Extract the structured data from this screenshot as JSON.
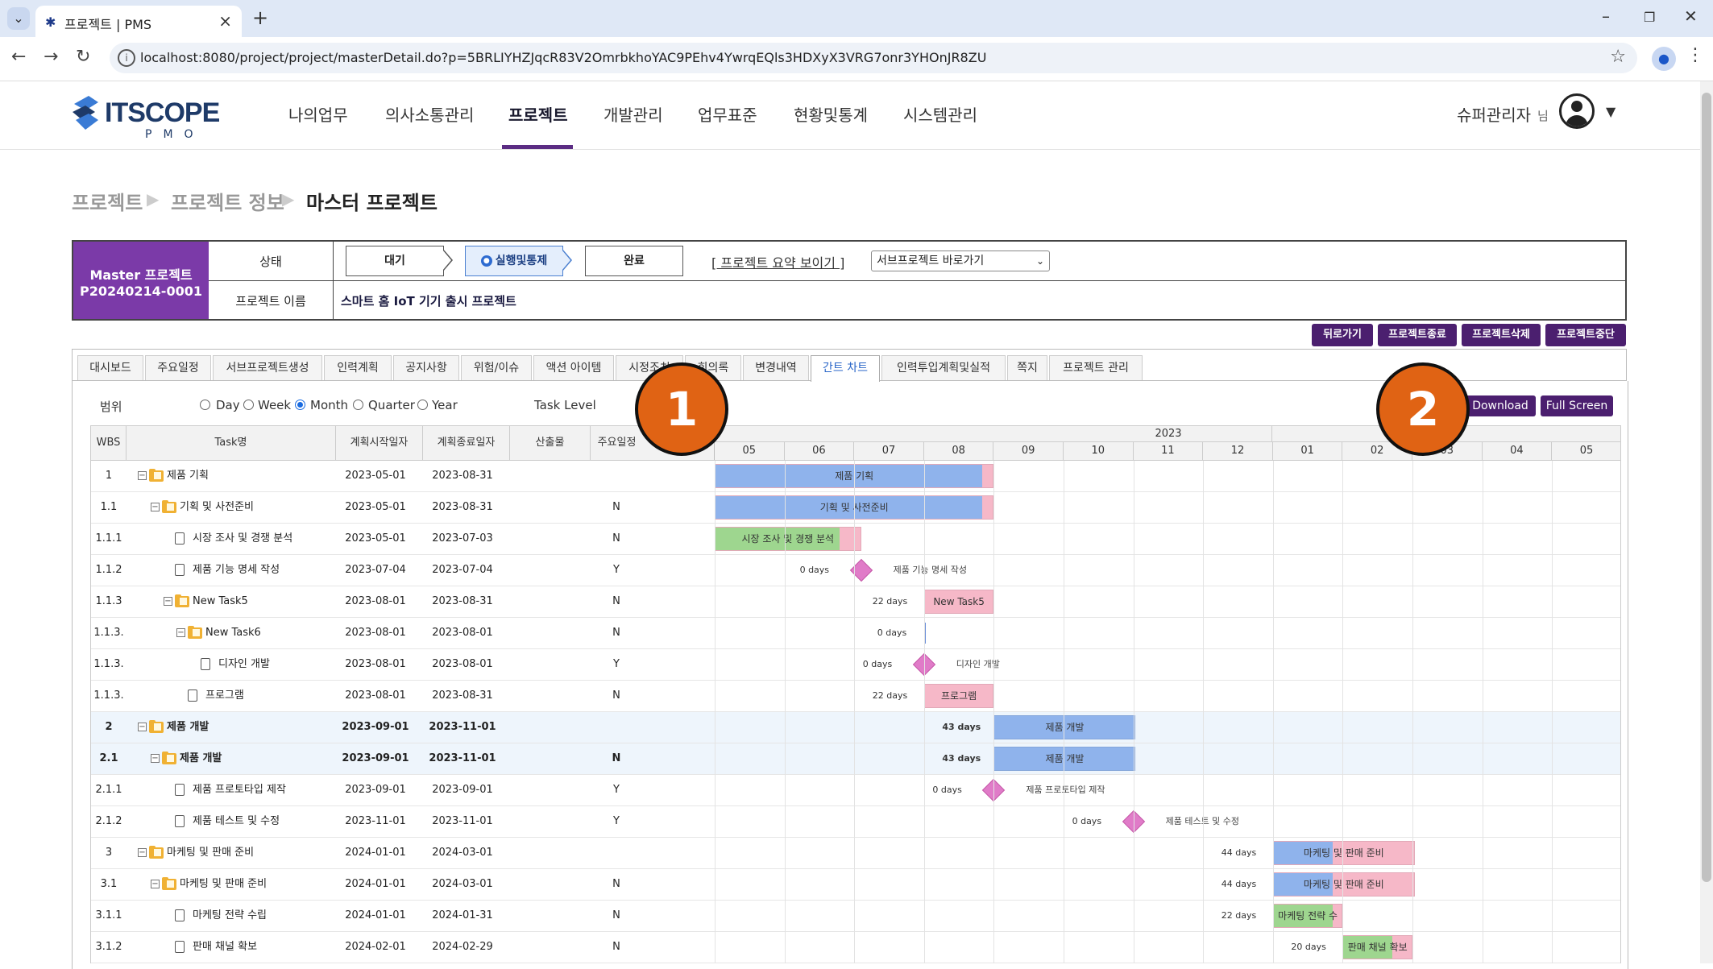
{
  "browser": {
    "tab_title": "프로젝트 | PMS",
    "url": "localhost:8080/project/project/masterDetail.do?p=5BRLIYHZJqcR83V2OmrbkhoYAC9PEhv4YwrqEQls3HDXyX3VRG7onr3YHOnJR8ZU"
  },
  "header": {
    "logo_text": "ITSCOPE",
    "logo_sub": "PMO",
    "nav": [
      "나의업무",
      "의사소통관리",
      "프로젝트",
      "개발관리",
      "업무표준",
      "현황및통계",
      "시스템관리"
    ],
    "active_nav": "프로젝트",
    "user_name": "슈퍼관리자",
    "user_suffix": "님"
  },
  "breadcrumb": [
    "프로젝트",
    "프로젝트 정보",
    "마스터 프로젝트"
  ],
  "project": {
    "type_label": "Master 프로젝트",
    "code": "P20240214-0001",
    "status_label": "상태",
    "name_label": "프로젝트 이름",
    "name": "스마트 홈 IoT 기기 출시 프로젝트",
    "steps": [
      "대기",
      "실행및통제",
      "완료"
    ],
    "active_step": "실행및통제",
    "summary_link": "[ 프로젝트 요약 보이기 ]",
    "subproject_select": "서브프로젝트 바로가기"
  },
  "actions": [
    "뒤로가기",
    "프로젝트종료",
    "프로젝트삭제",
    "프로젝트중단"
  ],
  "tabs": [
    "대시보드",
    "주요일정",
    "서브프로젝트생성",
    "인력계획",
    "공지사항",
    "위험/이슈",
    "액션 아이템",
    "시정조치",
    "회의록",
    "변경내역",
    "간트 차트",
    "인력투입계획및실적",
    "쪽지",
    "프로젝트 관리"
  ],
  "active_tab": "간트 차트",
  "gantt": {
    "range_label": "범위",
    "scales": [
      "Day",
      "Week",
      "Month",
      "Quarter",
      "Year"
    ],
    "selected_scale": "Month",
    "task_level_label": "Task Level",
    "download_label": "Download",
    "fullscreen_label": "Full Screen",
    "columns": [
      "WBS",
      "Task명",
      "계획시작일자",
      "계획종료일자",
      "산출물",
      "주요일정"
    ],
    "year_label": "2023",
    "months": [
      "05",
      "06",
      "07",
      "08",
      "09",
      "10",
      "11",
      "12",
      "01",
      "02",
      "03",
      "04",
      "05"
    ],
    "tasks": [
      {
        "wbs": "1",
        "name": "제품 기획",
        "start": "2023-05-01",
        "end": "2023-08-31",
        "milestone": "",
        "type": "folder",
        "bar_label": "제품 기획",
        "color": "blue",
        "days": ""
      },
      {
        "wbs": "1.1",
        "name": "기획 및 사전준비",
        "start": "2023-05-01",
        "end": "2023-08-31",
        "milestone": "N",
        "type": "folder",
        "bar_label": "기획 및 사전준비",
        "color": "blue",
        "days": ""
      },
      {
        "wbs": "1.1.1",
        "name": "시장 조사 및 경쟁 분석",
        "start": "2023-05-01",
        "end": "2023-07-03",
        "milestone": "N",
        "type": "doc",
        "bar_label": "시장 조사 및 경쟁 분석",
        "color": "green",
        "days": ""
      },
      {
        "wbs": "1.1.2",
        "name": "제품 기능 명세 작성",
        "start": "2023-07-04",
        "end": "2023-07-04",
        "milestone": "Y",
        "type": "doc",
        "bar_label": "제품 기능 명세 작성",
        "color": "diamond",
        "days": "0 days"
      },
      {
        "wbs": "1.1.3",
        "name": "New Task5",
        "start": "2023-08-01",
        "end": "2023-08-31",
        "milestone": "N",
        "type": "folder",
        "bar_label": "New Task5",
        "color": "pink",
        "days": "22 days"
      },
      {
        "wbs": "1.1.3.",
        "name": "New Task6",
        "start": "2023-08-01",
        "end": "2023-08-01",
        "milestone": "N",
        "type": "folder",
        "bar_label": "",
        "color": "line",
        "days": "0 days"
      },
      {
        "wbs": "1.1.3.",
        "name": "디자인 개발",
        "start": "2023-08-01",
        "end": "2023-08-01",
        "milestone": "Y",
        "type": "doc",
        "bar_label": "디자인 개발",
        "color": "diamond",
        "days": "0 days"
      },
      {
        "wbs": "1.1.3.",
        "name": "프로그램",
        "start": "2023-08-01",
        "end": "2023-08-31",
        "milestone": "N",
        "type": "doc",
        "bar_label": "프로그램",
        "color": "pink",
        "days": "22 days"
      },
      {
        "wbs": "2",
        "name": "제품 개발",
        "start": "2023-09-01",
        "end": "2023-11-01",
        "milestone": "",
        "type": "folder",
        "bar_label": "제품 개발",
        "color": "blue",
        "days": "43 days"
      },
      {
        "wbs": "2.1",
        "name": "제품 개발",
        "start": "2023-09-01",
        "end": "2023-11-01",
        "milestone": "N",
        "type": "folder",
        "bar_label": "제품 개발",
        "color": "blue",
        "days": "43 days"
      },
      {
        "wbs": "2.1.1",
        "name": "제품 프로토타입 제작",
        "start": "2023-09-01",
        "end": "2023-09-01",
        "milestone": "Y",
        "type": "doc",
        "bar_label": "제품 프로토타입 제작",
        "color": "diamond",
        "days": "0 days"
      },
      {
        "wbs": "2.1.2",
        "name": "제품 테스트 및 수정",
        "start": "2023-11-01",
        "end": "2023-11-01",
        "milestone": "Y",
        "type": "doc",
        "bar_label": "제품 테스트 및 수정",
        "color": "diamond",
        "days": "0 days"
      },
      {
        "wbs": "3",
        "name": "마케팅 및 판매 준비",
        "start": "2024-01-01",
        "end": "2024-03-01",
        "milestone": "",
        "type": "folder",
        "bar_label": "마케팅 및 판매 준비",
        "color": "bluepink",
        "days": "44 days"
      },
      {
        "wbs": "3.1",
        "name": "마케팅 및 판매 준비",
        "start": "2024-01-01",
        "end": "2024-03-01",
        "milestone": "N",
        "type": "folder",
        "bar_label": "마케팅 및 판매 준비",
        "color": "bluepink",
        "days": "44 days"
      },
      {
        "wbs": "3.1.1",
        "name": "마케팅 전략 수립",
        "start": "2024-01-01",
        "end": "2024-01-31",
        "milestone": "N",
        "type": "doc",
        "bar_label": "마케팅 전략 수",
        "color": "green",
        "days": "22 days"
      },
      {
        "wbs": "3.1.2",
        "name": "판매 채널 확보",
        "start": "2024-02-01",
        "end": "2024-02-29",
        "milestone": "N",
        "type": "doc",
        "bar_label": "판매 채널 확보",
        "color": "greenpink",
        "days": "20 days"
      }
    ]
  },
  "overlays": [
    "1",
    "2"
  ],
  "colors": {
    "brand_purple": "#4b1f6f",
    "master_purple": "#7b3aa8",
    "bar_blue": "#8fb3ec",
    "bar_green": "#9ed68f",
    "bar_pink": "#f6b8c8",
    "milestone": "#e07bc8",
    "overlay_orange": "#e06314"
  }
}
